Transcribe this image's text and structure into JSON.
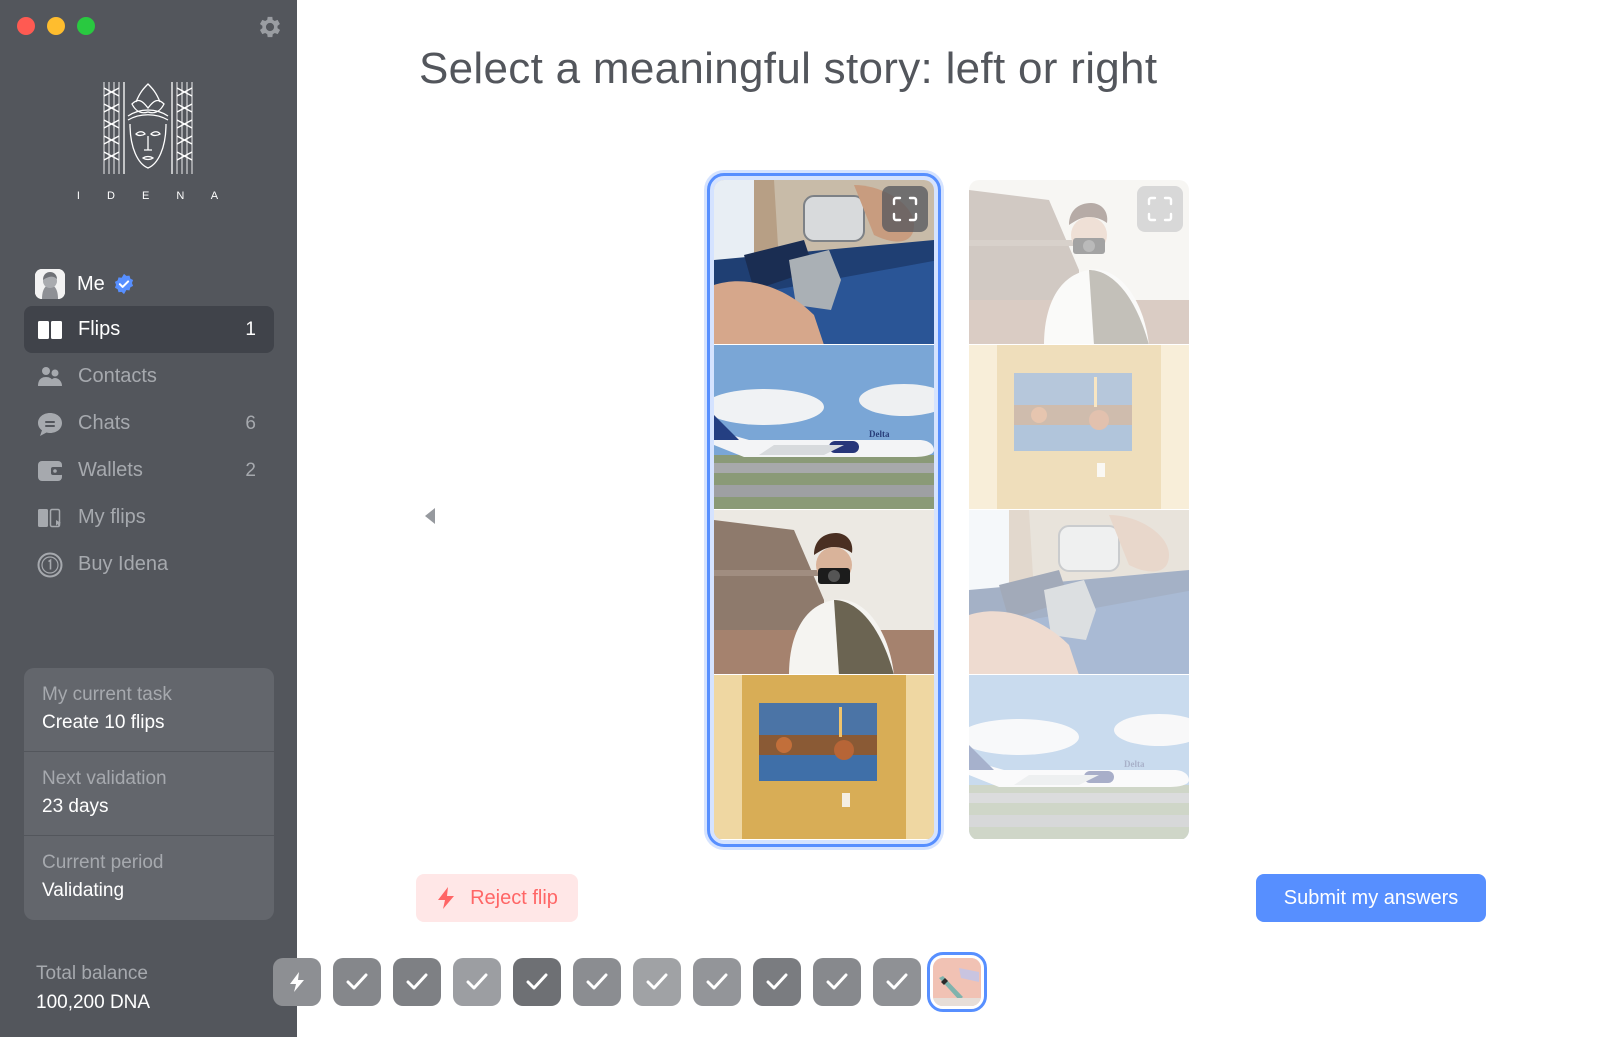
{
  "window": {
    "controls": [
      "close",
      "minimize",
      "maximize"
    ],
    "settings_icon": "gear-icon"
  },
  "brand": {
    "wordmark": "I D E N A",
    "logo_icon": "idena-face-logo"
  },
  "sidebar": {
    "profile": {
      "label": "Me",
      "verified": true,
      "avatar_icon": "user-avatar"
    },
    "items": [
      {
        "id": "flips",
        "label": "Flips",
        "count": "1",
        "icon": "flips-icon",
        "active": true
      },
      {
        "id": "contacts",
        "label": "Contacts",
        "count": "",
        "icon": "contacts-icon",
        "active": false
      },
      {
        "id": "chats",
        "label": "Chats",
        "count": "6",
        "icon": "chat-icon",
        "active": false
      },
      {
        "id": "wallets",
        "label": "Wallets",
        "count": "2",
        "icon": "wallet-icon",
        "active": false
      },
      {
        "id": "my-flips",
        "label": "My flips",
        "count": "",
        "icon": "my-flips-icon",
        "active": false
      },
      {
        "id": "buy-idena",
        "label": "Buy Idena",
        "count": "",
        "icon": "coin-icon",
        "active": false
      }
    ],
    "info": [
      {
        "label": "My current task",
        "value": "Create 10 flips"
      },
      {
        "label": "Next validation",
        "value": "23 days"
      },
      {
        "label": "Current period",
        "value": "Validating"
      }
    ],
    "balance": {
      "label": "Total balance",
      "value": "100,200 DNA"
    }
  },
  "main": {
    "title": "Select a meaningful story: left or right",
    "left_flip": {
      "selected": true,
      "panels": [
        "seatbelt buckle",
        "Delta airplane on runway",
        "man with camera",
        "framed painting on yellow wall"
      ]
    },
    "right_flip": {
      "selected": false,
      "panels": [
        "man with camera",
        "framed painting on yellow wall",
        "seatbelt buckle",
        "Delta airplane on runway"
      ]
    },
    "reject_button": "Reject flip",
    "submit_button": "Submit my answers",
    "colors": {
      "accent": "#578fff",
      "danger": "#ff6666",
      "danger_bg": "#ffe7e7",
      "sidebar_bg": "#53565c"
    },
    "thumbnails": [
      {
        "state": "rejected"
      },
      {
        "state": "answered"
      },
      {
        "state": "answered"
      },
      {
        "state": "answered"
      },
      {
        "state": "answered"
      },
      {
        "state": "answered"
      },
      {
        "state": "answered"
      },
      {
        "state": "answered"
      },
      {
        "state": "answered"
      },
      {
        "state": "answered"
      },
      {
        "state": "answered"
      },
      {
        "state": "current"
      }
    ]
  }
}
